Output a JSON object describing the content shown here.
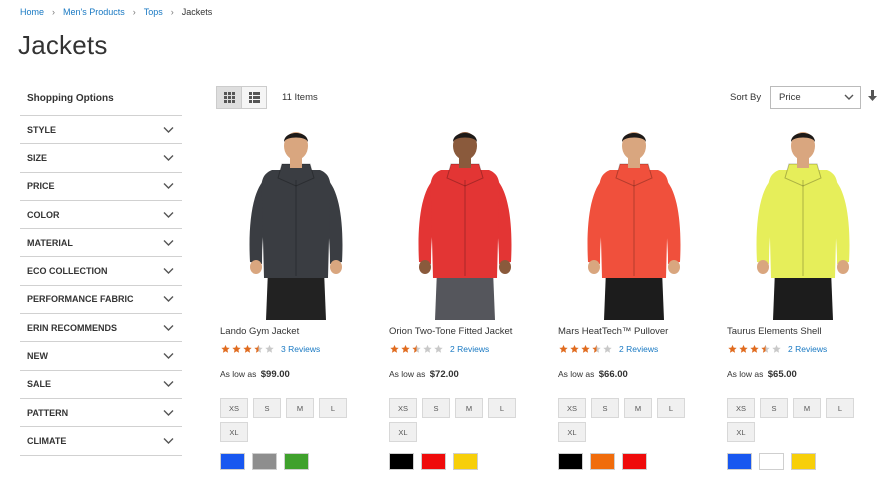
{
  "breadcrumb": {
    "home": "Home",
    "mens_products": "Men's Products",
    "tops": "Tops",
    "current": "Jackets"
  },
  "page_title": "Jackets",
  "sidebar": {
    "title": "Shopping Options",
    "filters": [
      "Style",
      "Size",
      "Price",
      "Color",
      "Material",
      "Eco Collection",
      "Performance Fabric",
      "Erin Recommends",
      "New",
      "Sale",
      "Pattern",
      "Climate"
    ]
  },
  "toolbar": {
    "items_count": "11 Items",
    "sort_label": "Sort By",
    "sort_value": "Price"
  },
  "products": [
    {
      "name": "Lando Gym Jacket",
      "rating": 3.5,
      "reviews": "3  Reviews",
      "price_prefix": "As low as",
      "price": "$99.00",
      "sizes": [
        "XS",
        "S",
        "M",
        "L",
        "XL"
      ],
      "colors": [
        "#1857f0",
        "#8e8e8e",
        "#3fa12c"
      ],
      "jacket_color": "#3a3d42",
      "pants_color": "#222222",
      "skin": "#d9a67f"
    },
    {
      "name": "Orion Two-Tone Fitted Jacket",
      "rating": 2.5,
      "reviews": "2  Reviews",
      "price_prefix": "As low as",
      "price": "$72.00",
      "sizes": [
        "XS",
        "S",
        "M",
        "L",
        "XL"
      ],
      "colors": [
        "#000000",
        "#ef0b0b",
        "#f7cf0a"
      ],
      "jacket_color": "#e33534",
      "pants_color": "#55565c",
      "skin": "#8a5a3c"
    },
    {
      "name": "Mars HeatTech™ Pullover",
      "rating": 3.5,
      "reviews": "2  Reviews",
      "price_prefix": "As low as",
      "price": "$66.00",
      "sizes": [
        "XS",
        "S",
        "M",
        "L",
        "XL"
      ],
      "colors": [
        "#000000",
        "#f06c0c",
        "#ef0b0b"
      ],
      "jacket_color": "#f0503c",
      "pants_color": "#1c1c1c",
      "skin": "#d9a67f"
    },
    {
      "name": "Taurus Elements Shell",
      "rating": 3.5,
      "reviews": "2  Reviews",
      "price_prefix": "As low as",
      "price": "$65.00",
      "sizes": [
        "XS",
        "S",
        "M",
        "L",
        "XL"
      ],
      "colors": [
        "#1857f0",
        "#ffffff",
        "#f7cf0a"
      ],
      "jacket_color": "#e6ee5a",
      "pants_color": "#1c1c1c",
      "skin": "#d9a67f"
    }
  ],
  "colors": {
    "link": "#1979c3",
    "star": "#e06b1f",
    "star_empty": "#c9c9c9"
  }
}
